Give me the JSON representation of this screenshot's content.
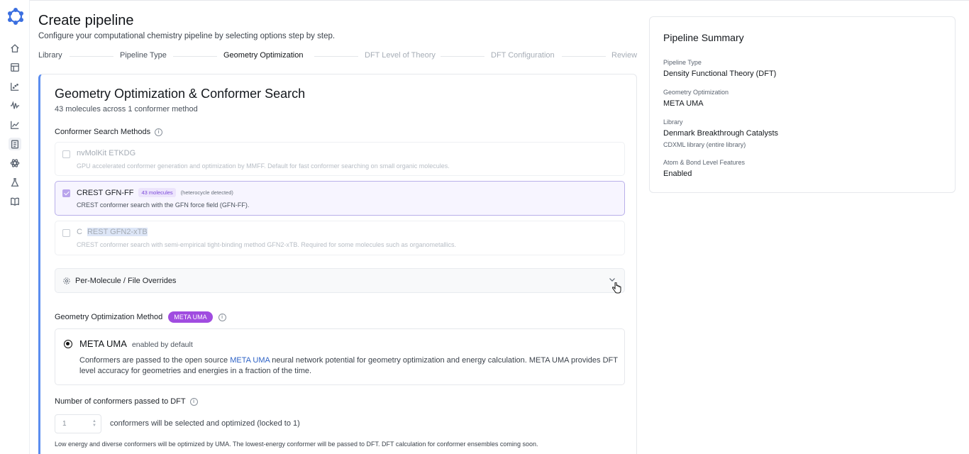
{
  "header": {
    "title": "Create pipeline",
    "subtitle": "Configure your computational chemistry pipeline by selecting options step by step."
  },
  "steps": [
    {
      "label": "Library",
      "state": "done"
    },
    {
      "label": "Pipeline Type",
      "state": "done"
    },
    {
      "label": "Geometry Optimization",
      "state": "current"
    },
    {
      "label": "DFT Level of Theory",
      "state": "todo"
    },
    {
      "label": "DFT Configuration",
      "state": "todo"
    },
    {
      "label": "Review",
      "state": "todo"
    }
  ],
  "card": {
    "title": "Geometry Optimization & Conformer Search",
    "subtitle": "43 molecules across 1 conformer method",
    "conformer_label": "Conformer Search Methods",
    "methods": [
      {
        "title": "nvMolKit ETKDG",
        "desc": "GPU accelerated conformer generation and optimization by MMFF. Default for fast conformer searching on small organic molecules.",
        "checked": false,
        "disabled": true
      },
      {
        "title": "CREST GFN-FF",
        "badge": "43 molecules",
        "note": "(heterocycle detected)",
        "desc": "CREST conformer search with the GFN force field (GFN-FF).",
        "checked": true,
        "disabled": false
      },
      {
        "title_a": "C",
        "title_b": "REST GFN2-xTB",
        "desc": "CREST conformer search with semi-empirical tight-binding method GFN2-xTB. Required for some molecules such as organometallics.",
        "checked": false,
        "disabled": true
      }
    ],
    "overrides_label": "Per-Molecule / File Overrides",
    "geo_label": "Geometry Optimization Method",
    "geo_pill": "META UMA",
    "uma": {
      "title": "META UMA",
      "sub": "enabled by default",
      "desc_a": "Conformers are passed to the open source ",
      "desc_link": "META UMA",
      "desc_b": " neural network potential for geometry optimization and energy calculation. META UMA provides DFT level accuracy for geometries and energies in a fraction of the time."
    },
    "num_label": "Number of conformers passed to DFT",
    "num_value": "1",
    "num_after": "conformers will be selected and optimized (locked to 1)",
    "num_note": "Low energy and diverse conformers will be optimized by UMA. The lowest-energy conformer will be passed to DFT. DFT calculation for conformer ensembles coming soon."
  },
  "summary": {
    "title": "Pipeline Summary",
    "items": [
      {
        "key": "Pipeline Type",
        "value": "Density Functional Theory (DFT)"
      },
      {
        "key": "Geometry Optimization",
        "value": "META UMA"
      },
      {
        "key": "Library",
        "value": "Denmark Breakthrough Catalysts",
        "note": "CDXML library (entire library)"
      },
      {
        "key": "Atom & Bond Level Features",
        "value": "Enabled"
      }
    ]
  },
  "colors": {
    "accent": "#5b8def",
    "purple": "#a04ce0",
    "link": "#2f63c6"
  }
}
